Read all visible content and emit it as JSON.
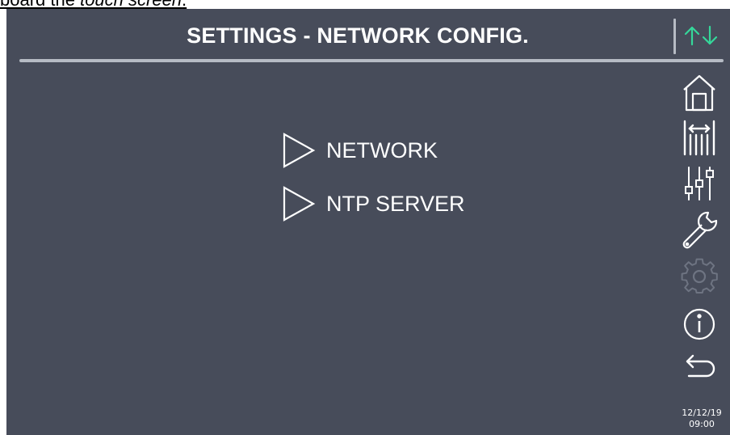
{
  "caption": {
    "before": "board the ",
    "italic": "touch screen",
    "after": "."
  },
  "header": {
    "title": "SETTINGS - NETWORK CONFIG."
  },
  "menu": {
    "items": [
      {
        "label": "NETWORK",
        "icon": "triangle-right-icon"
      },
      {
        "label": "NTP SERVER",
        "icon": "triangle-right-icon"
      }
    ]
  },
  "sidebar": {
    "icons": [
      "home-icon",
      "measurements-icon",
      "sliders-icon",
      "wrench-icon",
      "gear-icon",
      "info-icon",
      "back-icon"
    ],
    "inactive_icon": "gear-icon"
  },
  "status": {
    "date": "12/12/19",
    "time": "09:00",
    "connection_icon": "up-down-arrows-icon"
  },
  "colors": {
    "background": "#474c5a",
    "foreground": "#ffffff",
    "rule": "#b6bbc4",
    "connection_arrows": "#35d79a",
    "inactive_icon": "#6e7482"
  }
}
